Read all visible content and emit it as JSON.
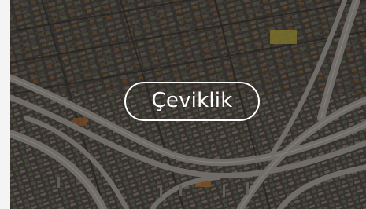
{
  "card": {
    "image_subject": "aerial-highway-interchange",
    "category_label": "Çeviklik"
  },
  "colors": {
    "page_background": "#f4f4f4",
    "label_text": "#ffffff",
    "label_border": "#ffffff",
    "image_tint": "#2a2826"
  }
}
